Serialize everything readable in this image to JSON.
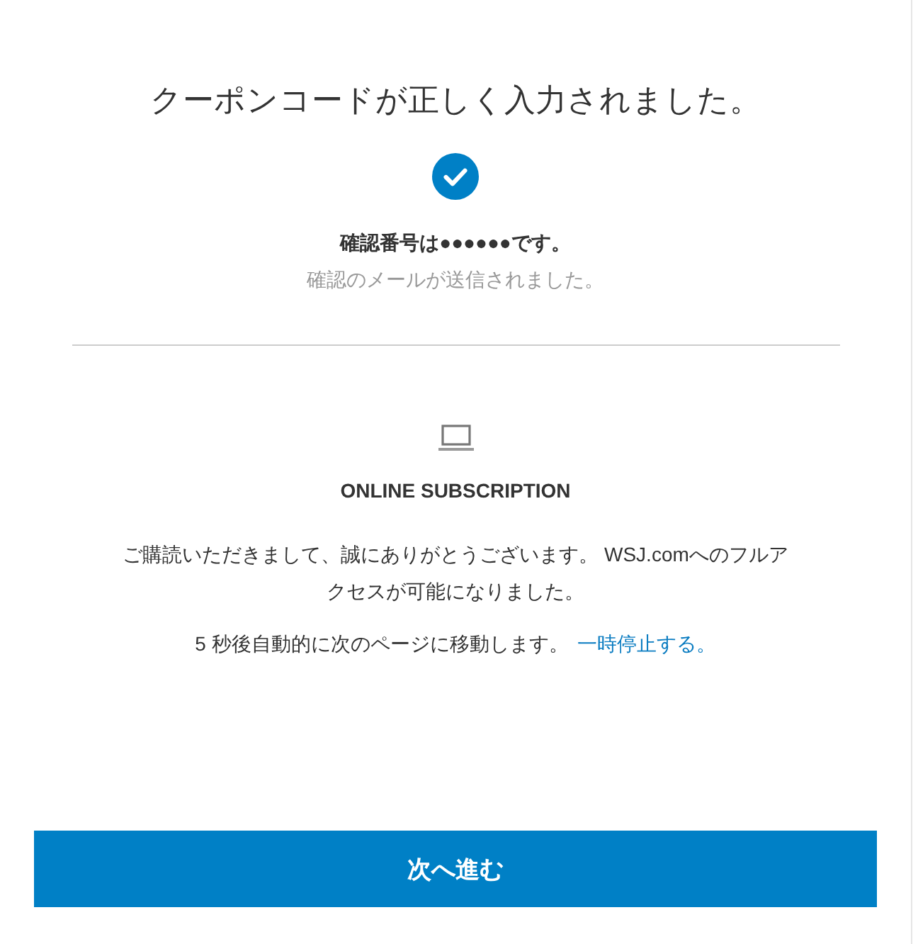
{
  "title": "クーポンコードが正しく入力されました。",
  "confirmation": {
    "number_text": "確認番号は●●●●●●です。",
    "email_note": "確認のメールが送信されました。"
  },
  "subscription": {
    "heading": "ONLINE SUBSCRIPTION",
    "message": "ご購読いただきまして、誠にありがとうございます。 WSJ.comへのフルアクセスが可能になりました。",
    "redirect_text": "5 秒後自動的に次のページに移動します。",
    "pause_link": "一時停止する。"
  },
  "button": {
    "label": "次へ進む"
  }
}
